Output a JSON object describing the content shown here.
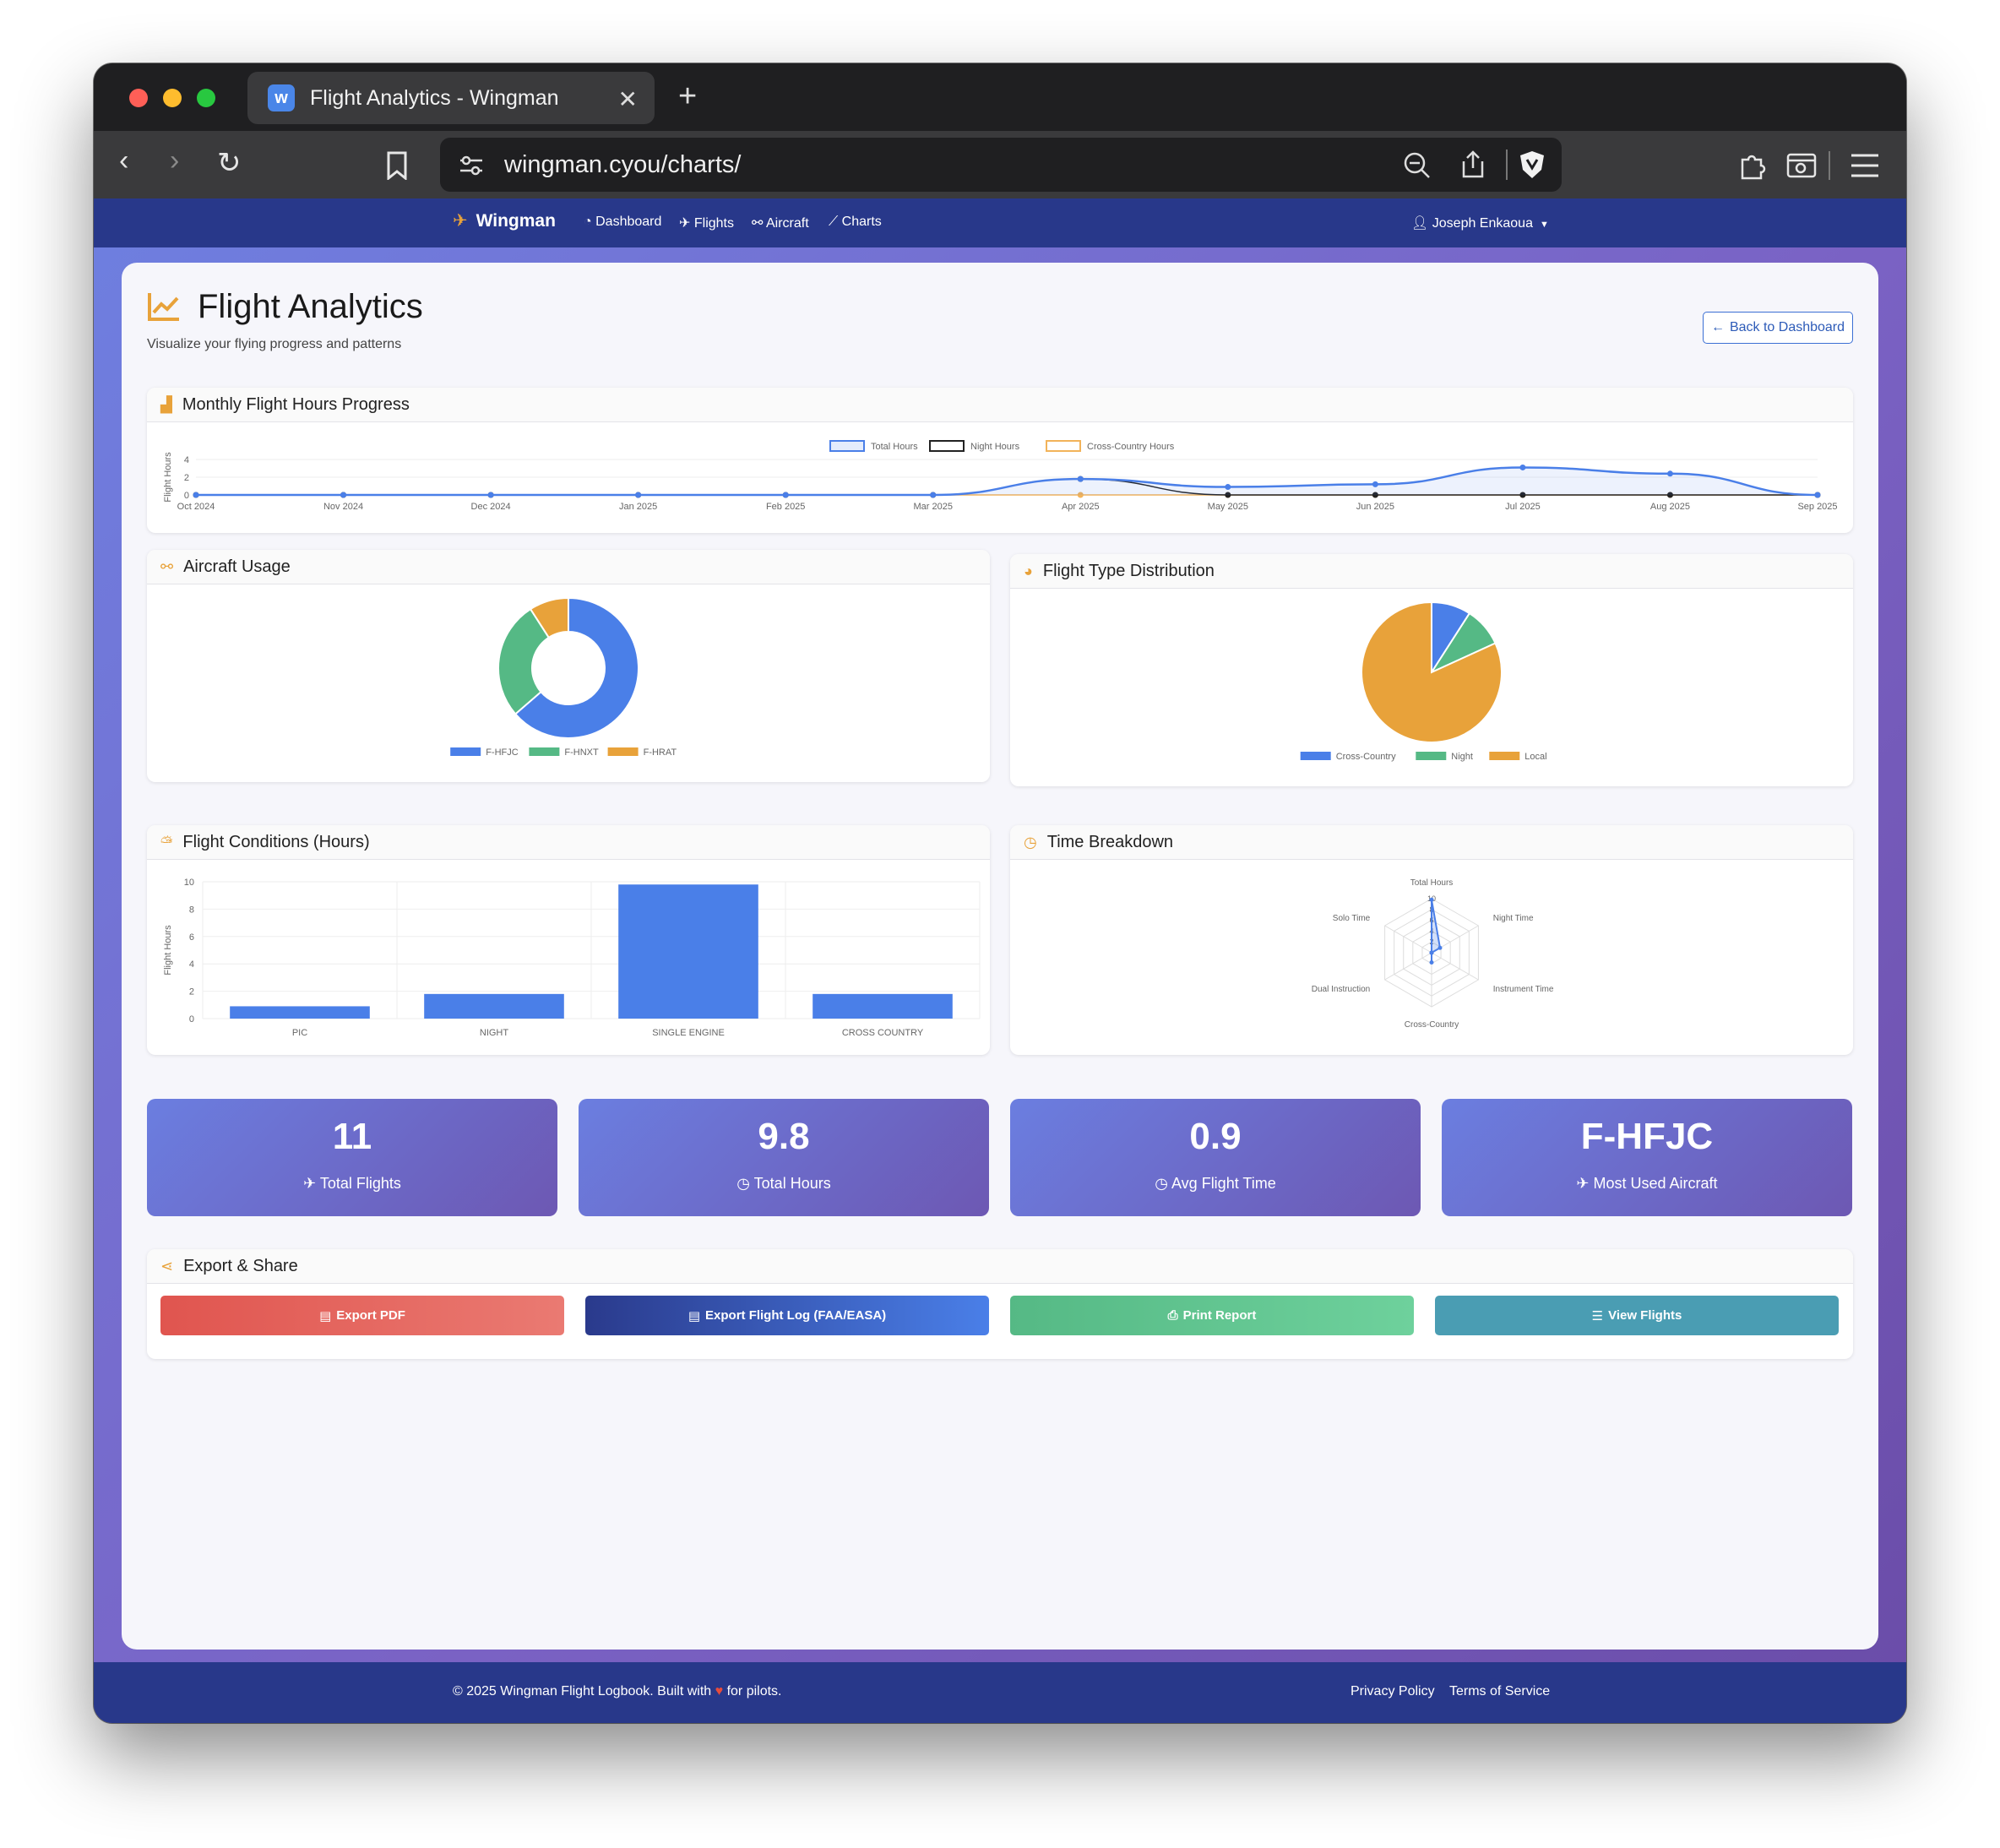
{
  "browser": {
    "tab_title": "Flight Analytics - Wingman",
    "favicon_letter": "w",
    "url": "wingman.cyou/charts/"
  },
  "nav": {
    "brand": "Wingman",
    "links": [
      "Dashboard",
      "Flights",
      "Aircraft",
      "Charts"
    ],
    "user": "Joseph Enkaoua"
  },
  "page": {
    "title": "Flight Analytics",
    "subtitle": "Visualize your flying progress and patterns",
    "back_button": "Back to Dashboard"
  },
  "cards": {
    "monthly": "Monthly Flight Hours Progress",
    "aircraft_usage": "Aircraft Usage",
    "flight_type": "Flight Type Distribution",
    "conditions": "Flight Conditions (Hours)",
    "time_breakdown": "Time Breakdown",
    "export": "Export & Share"
  },
  "stats": [
    {
      "value": "11",
      "label": "Total Flights"
    },
    {
      "value": "9.8",
      "label": "Total Hours"
    },
    {
      "value": "0.9",
      "label": "Avg Flight Time"
    },
    {
      "value": "F-HFJC",
      "label": "Most Used Aircraft"
    }
  ],
  "export_buttons": [
    {
      "label": "Export PDF",
      "color": "#e0554f"
    },
    {
      "label": "Export Flight Log (FAA/EASA)",
      "color": "#2d3d99"
    },
    {
      "label": "Print Report",
      "color": "#55b985"
    },
    {
      "label": "View Flights",
      "color": "#4a9db3"
    }
  ],
  "footer": {
    "copyright": "© 2025 Wingman Flight Logbook. Built with",
    "copyright_end": "for pilots.",
    "links": [
      "Privacy Policy",
      "Terms of Service"
    ]
  },
  "chart_data": [
    {
      "type": "line",
      "ylabel": "Flight Hours",
      "ylim": [
        0,
        4
      ],
      "yticks": [
        0,
        2,
        4
      ],
      "x": [
        "Oct 2024",
        "Nov 2024",
        "Dec 2024",
        "Jan 2025",
        "Feb 2025",
        "Mar 2025",
        "Apr 2025",
        "May 2025",
        "Jun 2025",
        "Jul 2025",
        "Aug 2025",
        "Sep 2025"
      ],
      "series": [
        {
          "name": "Total Hours",
          "color": "#4a7fe8",
          "values": [
            0,
            0,
            0,
            0,
            0,
            0,
            1.8,
            0.9,
            1.2,
            3.1,
            2.4,
            0
          ]
        },
        {
          "name": "Night Hours",
          "color": "#222222",
          "values": [
            0,
            0,
            0,
            0,
            0,
            0,
            1.8,
            0,
            0,
            0,
            0,
            0
          ]
        },
        {
          "name": "Cross-Country Hours",
          "color": "#f2b35a",
          "values": [
            0,
            0,
            0,
            0,
            0,
            0,
            0,
            0,
            0,
            0,
            0,
            0
          ]
        }
      ]
    },
    {
      "type": "pie",
      "variant": "doughnut",
      "categories": [
        "F-HFJC",
        "F-HNXT",
        "F-HRAT"
      ],
      "values": [
        7,
        3,
        1
      ],
      "colors": [
        "#4a7fe8",
        "#55b985",
        "#e8a23a"
      ]
    },
    {
      "type": "pie",
      "categories": [
        "Cross-Country",
        "Night",
        "Local"
      ],
      "values": [
        1,
        1,
        9
      ],
      "colors": [
        "#4a7fe8",
        "#55b985",
        "#e8a23a"
      ]
    },
    {
      "type": "bar",
      "ylabel": "Flight Hours",
      "ylim": [
        0,
        10
      ],
      "yticks": [
        0,
        2,
        4,
        6,
        8,
        10
      ],
      "categories": [
        "PIC",
        "NIGHT",
        "SINGLE ENGINE",
        "CROSS COUNTRY"
      ],
      "values": [
        0.9,
        1.8,
        9.8,
        1.8
      ],
      "color": "#4a7fe8"
    },
    {
      "type": "radar",
      "axes": [
        "Total Hours",
        "Night Time",
        "Instrument Time",
        "Cross-Country",
        "Dual Instruction",
        "Solo Time"
      ],
      "values": [
        9.8,
        1.8,
        0,
        1.8,
        0,
        0
      ],
      "rmax": 10,
      "ticks": [
        2,
        4,
        6,
        8,
        10
      ],
      "color": "#4a7fe8"
    }
  ]
}
